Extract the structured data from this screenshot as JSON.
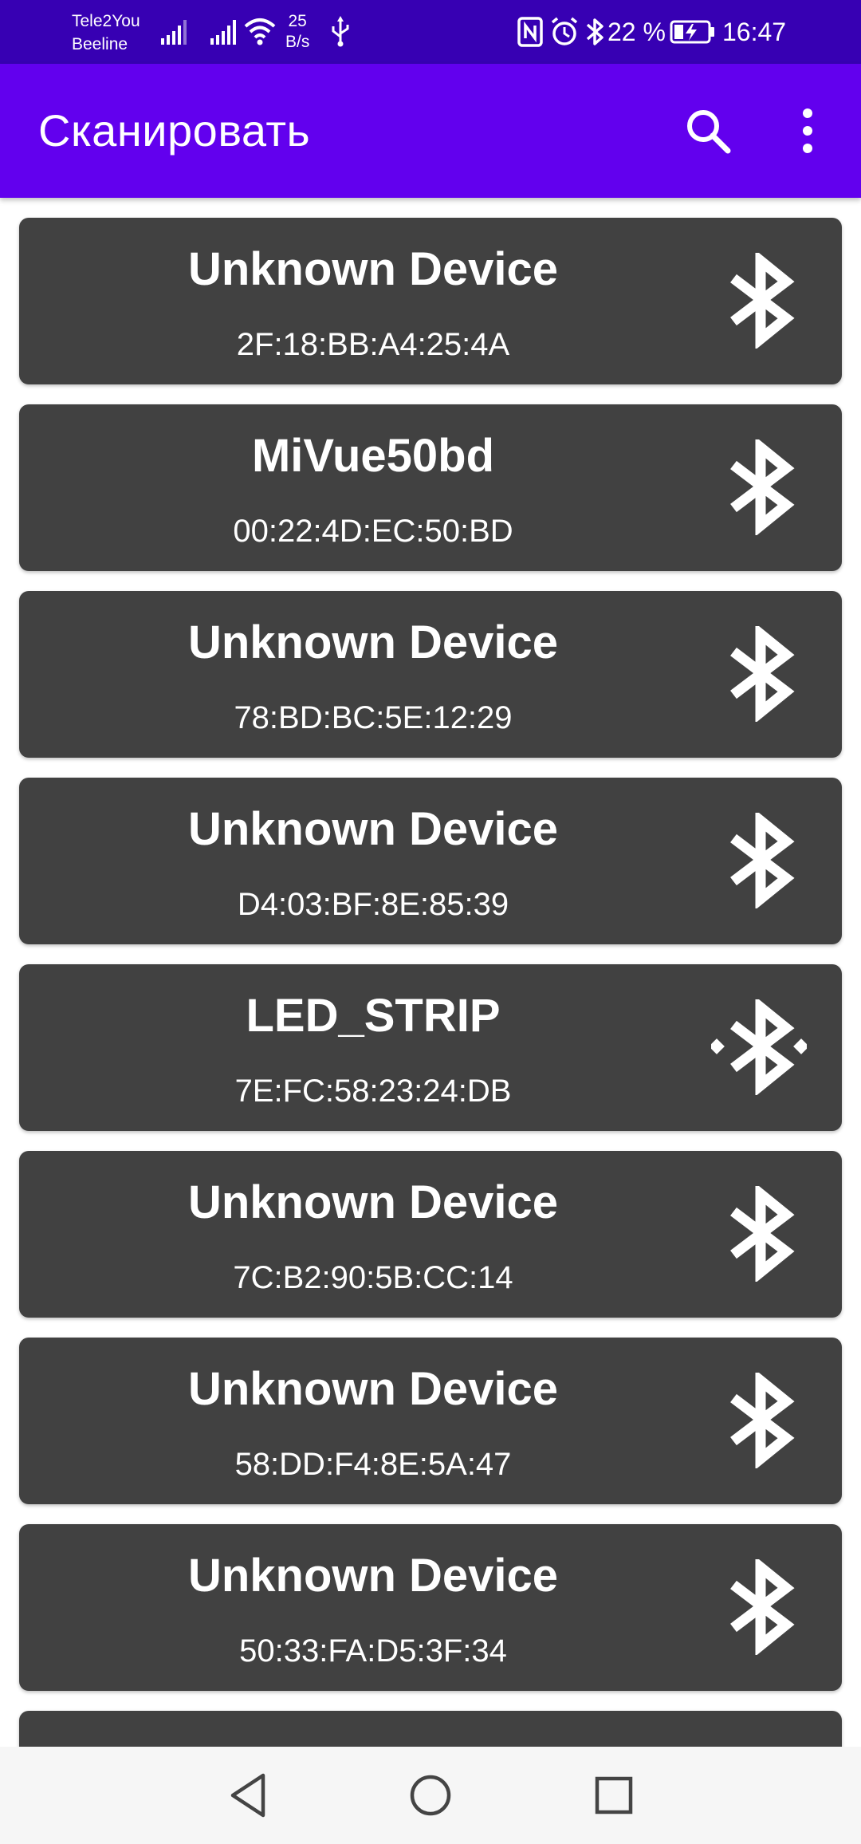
{
  "status_bar": {
    "carrier_1": "Tele2You",
    "carrier_2": "Beeline",
    "net_speed_value": "25",
    "net_speed_unit": "B/s",
    "battery": "22 %",
    "time": "16:47"
  },
  "app_bar": {
    "title": "Сканировать",
    "actions": [
      "search-icon",
      "more-vert-icon"
    ],
    "background": "#6200ee",
    "status_background": "#3700b3"
  },
  "devices": [
    {
      "name": "Unknown Device",
      "mac": "2F:18:BB:A4:25:4A",
      "icon": "bluetooth-icon"
    },
    {
      "name": "MiVue50bd",
      "mac": "00:22:4D:EC:50:BD",
      "icon": "bluetooth-icon"
    },
    {
      "name": "Unknown Device",
      "mac": "78:BD:BC:5E:12:29",
      "icon": "bluetooth-icon"
    },
    {
      "name": "Unknown Device",
      "mac": "D4:03:BF:8E:85:39",
      "icon": "bluetooth-icon"
    },
    {
      "name": "LED_STRIP",
      "mac": "7E:FC:58:23:24:DB",
      "icon": "bluetooth-connected-icon"
    },
    {
      "name": "Unknown Device",
      "mac": "7C:B2:90:5B:CC:14",
      "icon": "bluetooth-icon"
    },
    {
      "name": "Unknown Device",
      "mac": "58:DD:F4:8E:5A:47",
      "icon": "bluetooth-icon"
    },
    {
      "name": "Unknown Device",
      "mac": "50:33:FA:D5:3F:34",
      "icon": "bluetooth-icon"
    },
    {
      "name": "",
      "mac": "",
      "icon": "bluetooth-icon"
    }
  ],
  "card_color": "#414141",
  "nav_bar": {
    "buttons": [
      "back-icon",
      "home-icon",
      "recents-icon"
    ]
  }
}
